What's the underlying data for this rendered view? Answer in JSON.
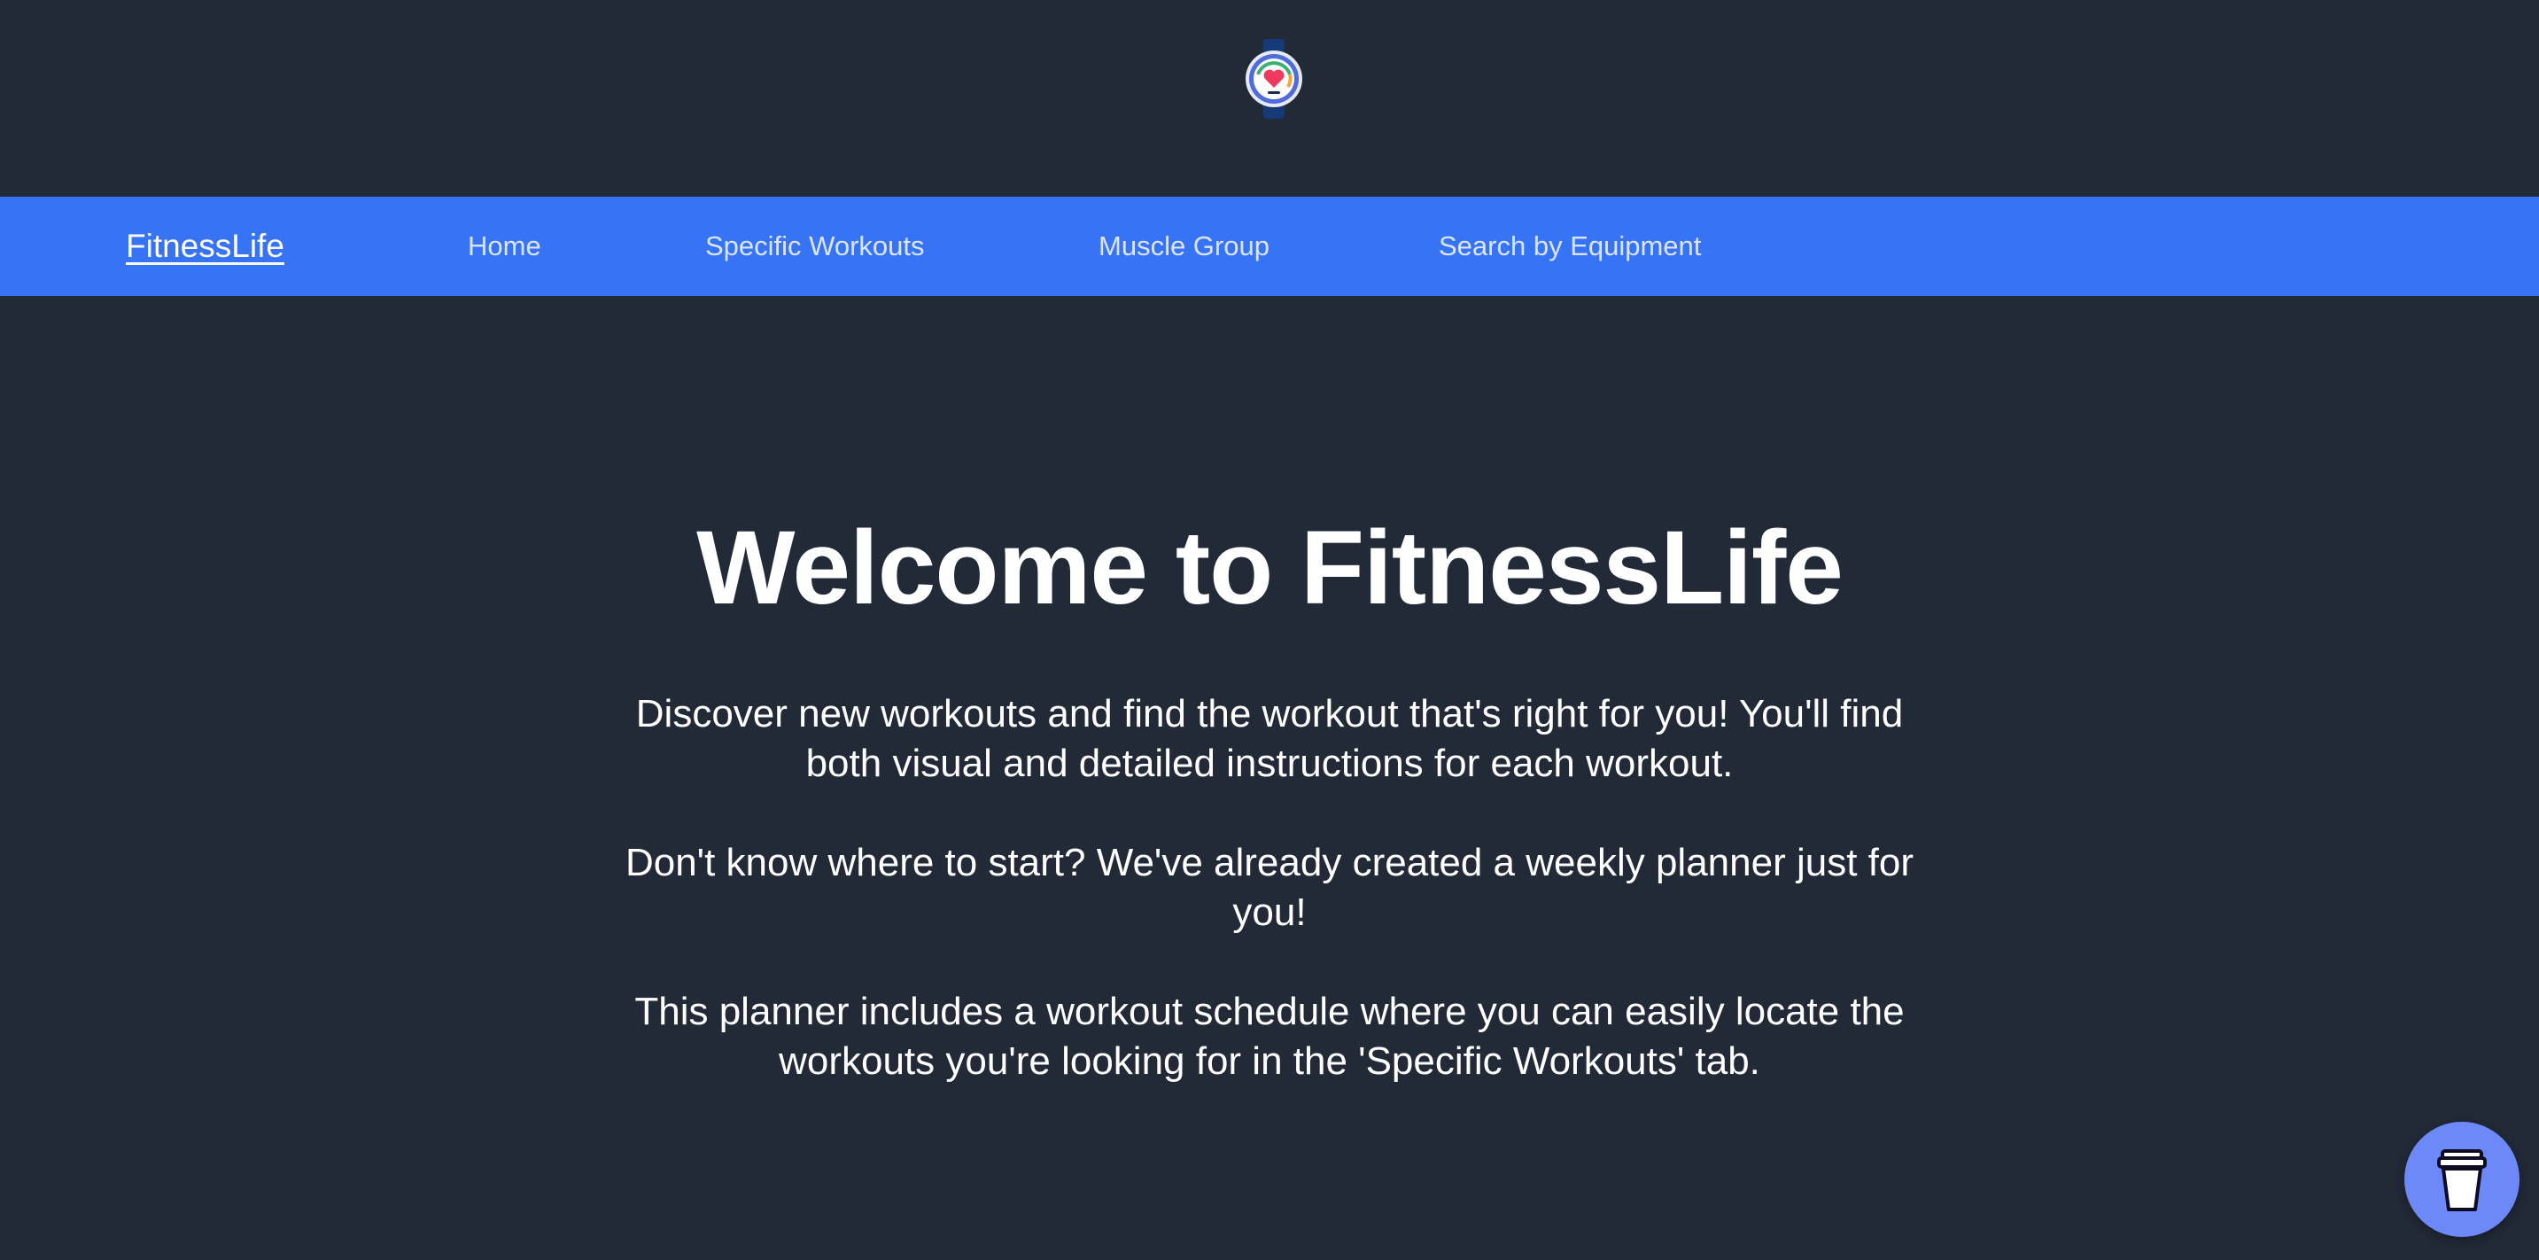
{
  "navbar": {
    "brand": "FitnessLife",
    "links": [
      "Home",
      "Specific Workouts",
      "Muscle Group",
      "Search by Equipment"
    ]
  },
  "hero": {
    "title": "Welcome to FitnessLife",
    "paragraphs": [
      "Discover new workouts and find the workout that's right for you! You'll find both visual and detailed instructions for each workout.",
      "Don't know where to start? We've already created a weekly planner just for you!",
      "This planner includes a workout schedule where you can easily locate the workouts you're looking for in the 'Specific Workouts' tab."
    ]
  },
  "icons": {
    "logo": "smartwatch-heart-icon",
    "floating_button": "coffee-cup-icon"
  },
  "colors": {
    "background": "#222937",
    "navbar": "#3673f5",
    "floating_button": "#6d88f7"
  }
}
